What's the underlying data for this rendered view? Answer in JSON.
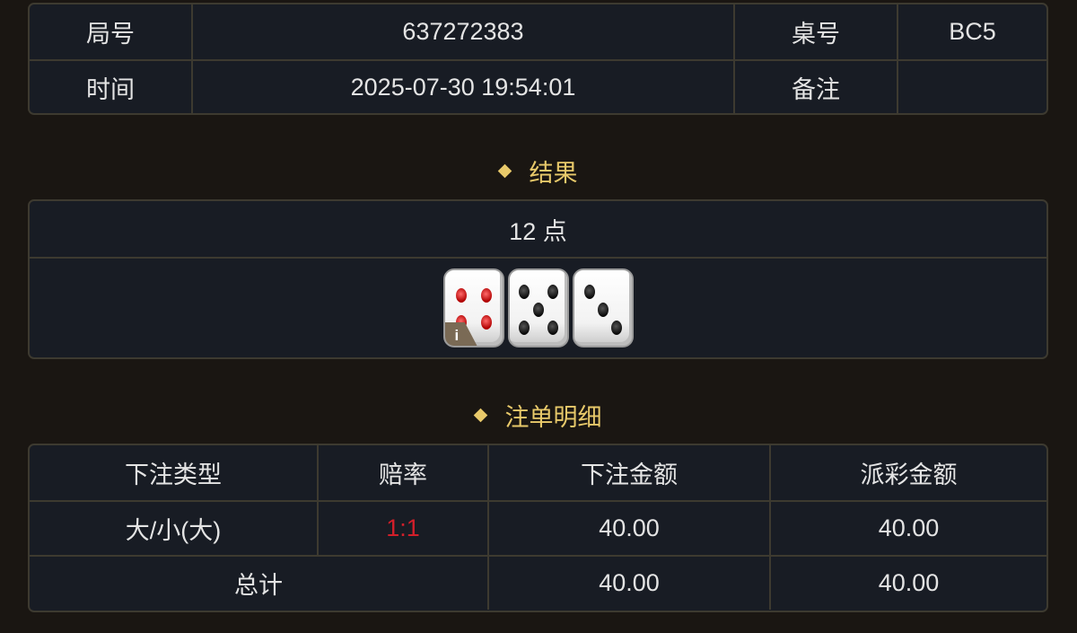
{
  "info": {
    "round_label": "局号",
    "round_value": "637272383",
    "table_label": "桌号",
    "table_value": "BC5",
    "time_label": "时间",
    "time_value": "2025-07-30 19:54:01",
    "note_label": "备注",
    "note_value": ""
  },
  "result": {
    "title": "结果",
    "points": "12 点",
    "dice": [
      4,
      5,
      3
    ],
    "info_icon": "i"
  },
  "bets": {
    "title": "注单明细",
    "headers": [
      "下注类型",
      "赔率",
      "下注金额",
      "派彩金额"
    ],
    "rows": [
      {
        "type": "大/小(大)",
        "odds": "1:1",
        "stake": "40.00",
        "payout": "40.00"
      }
    ],
    "total": {
      "label": "总计",
      "stake": "40.00",
      "payout": "40.00"
    }
  },
  "colors": {
    "background": "#1a1612",
    "panel": "#181c24",
    "border": "#3d3a30",
    "accent_gold": "#e8c96a",
    "odds_red": "#d21f2a"
  },
  "icons": [
    "diamond-bullet-icon",
    "info-icon",
    "die-icon"
  ]
}
